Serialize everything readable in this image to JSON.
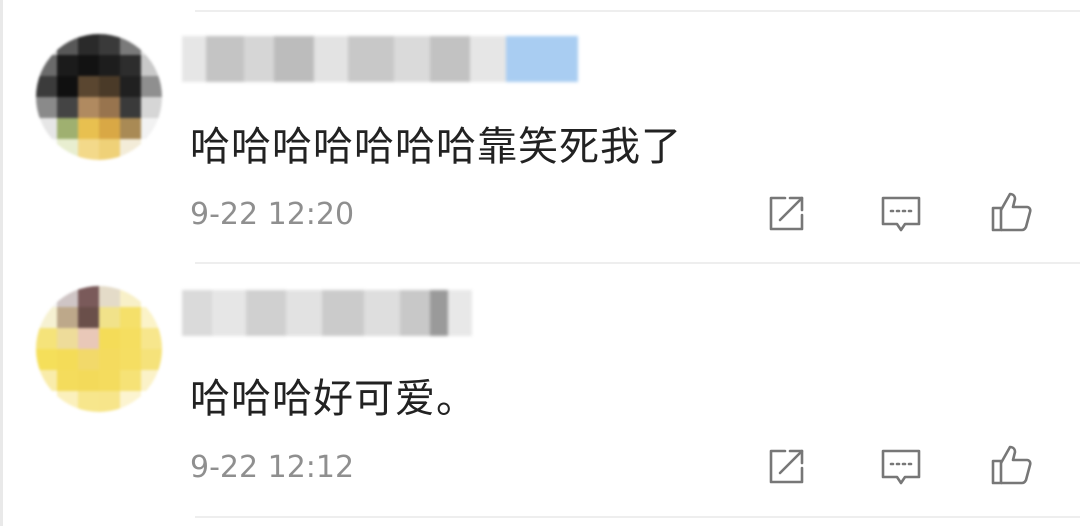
{
  "comments": [
    {
      "text": "哈哈哈哈哈哈哈靠笑死我了",
      "time": "9-22 12:20"
    },
    {
      "text": "哈哈哈好可爱。",
      "time": "9-22 12:12"
    }
  ],
  "icons": {
    "share": "share-icon",
    "reply": "comment-icon",
    "like": "thumbs-up-icon"
  },
  "colors": {
    "text": "#222222",
    "meta": "#8f8f8f",
    "icon": "#777777",
    "divider": "#eeeeee"
  }
}
